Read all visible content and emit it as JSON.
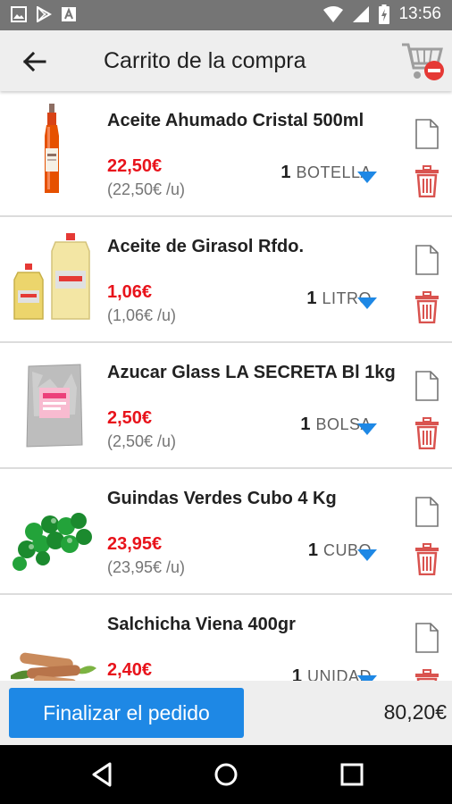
{
  "status_bar": {
    "time": "13:56",
    "left_icons": [
      "image-icon",
      "play-store-icon",
      "text-icon"
    ],
    "right_icons": [
      "wifi-icon",
      "signal-icon",
      "battery-icon"
    ]
  },
  "app_bar": {
    "title": "Carrito de la compra",
    "back_icon": "arrow-back-icon",
    "empty_cart_icon": "cart-remove-icon"
  },
  "colors": {
    "accent": "#1e88e5",
    "price": "#e8131b",
    "trash": "#d9534f",
    "dropdown": "#1e88e5"
  },
  "items": [
    {
      "name": "Aceite Ahumado Cristal 500ml",
      "price": "22,50€",
      "unit_price": "(22,50€ /u)",
      "qty": "1",
      "unit": "BOTELLA"
    },
    {
      "name": "Aceite de Girasol Rfdo.",
      "price": "1,06€",
      "unit_price": "(1,06€ /u)",
      "qty": "1",
      "unit": "LITRO"
    },
    {
      "name": "Azucar Glass LA SECRETA Bl 1kg",
      "price": "2,50€",
      "unit_price": "(2,50€ /u)",
      "qty": "1",
      "unit": "BOLSA"
    },
    {
      "name": "Guindas Verdes Cubo 4 Kg",
      "price": "23,95€",
      "unit_price": "(23,95€ /u)",
      "qty": "1",
      "unit": "CUBO"
    },
    {
      "name": "Salchicha Viena 400gr",
      "price": "2,40€",
      "unit_price": "",
      "qty": "1",
      "unit": "UNIDAD"
    }
  ],
  "bottom": {
    "finalize_label": "Finalizar el pedido",
    "total": "80,20€"
  }
}
